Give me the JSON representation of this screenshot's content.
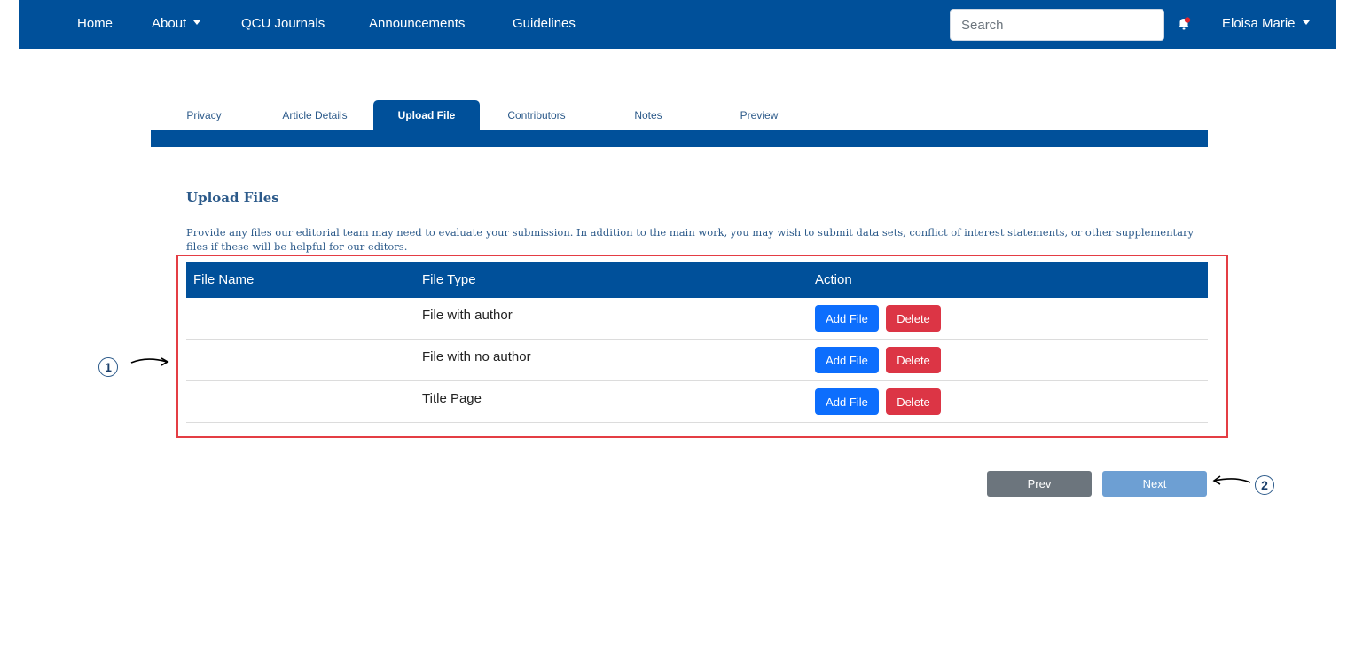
{
  "nav": {
    "home": "Home",
    "about": "About",
    "journals": "QCU Journals",
    "announcements": "Announcements",
    "guidelines": "Guidelines",
    "search_placeholder": "Search",
    "user": "Eloisa Marie"
  },
  "tabs": [
    {
      "label": "Privacy"
    },
    {
      "label": "Article Details"
    },
    {
      "label": "Upload File",
      "active": true
    },
    {
      "label": "Contributors"
    },
    {
      "label": "Notes"
    },
    {
      "label": "Preview"
    }
  ],
  "section": {
    "title": "Upload Files",
    "description": "Provide any files our editorial team may need to evaluate your submission. In addition to the main work, you may wish to submit data sets, conflict of interest statements, or other supplementary files if these will be helpful for our editors."
  },
  "table": {
    "headers": [
      "File Name",
      "File Type",
      "Action"
    ],
    "rows": [
      {
        "file_name": "",
        "file_type": "File with author",
        "add_label": "Add File",
        "delete_label": "Delete"
      },
      {
        "file_name": "",
        "file_type": "File with no author",
        "add_label": "Add File",
        "delete_label": "Delete"
      },
      {
        "file_name": "",
        "file_type": "Title Page",
        "add_label": "Add File",
        "delete_label": "Delete"
      }
    ]
  },
  "pager": {
    "prev": "Prev",
    "next": "Next"
  },
  "callouts": {
    "one": "1",
    "two": "2"
  },
  "colors": {
    "brand_blue": "#00509a",
    "add_button": "#0d6efd",
    "delete_button": "#dc3545",
    "prev_button": "#6c757d",
    "next_button": "#6d9fd3",
    "highlight": "#e43d44",
    "notification_dot": "#e0242e"
  }
}
